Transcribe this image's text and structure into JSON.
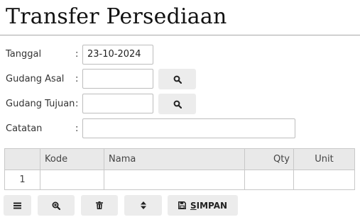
{
  "header": {
    "title": "Transfer Persediaan"
  },
  "form": {
    "colon": ":",
    "tanggal": {
      "label": "Tanggal",
      "value": "23-10-2024"
    },
    "gudang_asal": {
      "label": "Gudang Asal",
      "value": ""
    },
    "gudang_tujuan": {
      "label": "Gudang Tujuan",
      "value": ""
    },
    "catatan": {
      "label": "Catatan",
      "value": ""
    }
  },
  "table": {
    "columns": [
      "",
      "Kode",
      "Nama",
      "Qty",
      "Unit"
    ],
    "rows": [
      {
        "no": "1",
        "kode": "",
        "nama": "",
        "qty": "",
        "unit": ""
      }
    ]
  },
  "toolbar": {
    "save_first": "S",
    "save_rest": "IMPAN",
    "icons": [
      "menu-icon",
      "zoom-in-icon",
      "trash-icon",
      "sort-icon",
      "save-icon"
    ]
  }
}
